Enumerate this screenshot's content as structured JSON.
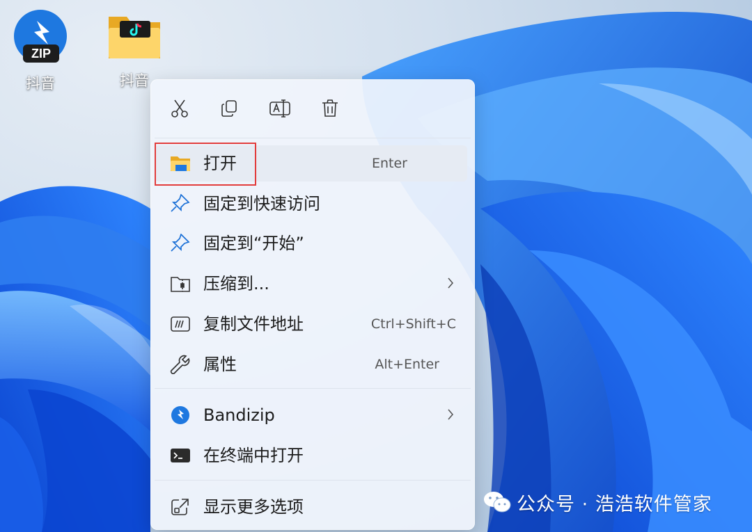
{
  "desktop": {
    "icons": [
      {
        "label": "抖音",
        "icon": "zip-archive-icon",
        "badge": "ZIP"
      },
      {
        "label": "抖音",
        "icon": "folder-icon"
      }
    ]
  },
  "context_menu": {
    "toolbar": [
      {
        "icon": "cut-icon"
      },
      {
        "icon": "copy-icon"
      },
      {
        "icon": "rename-icon"
      },
      {
        "icon": "delete-icon"
      }
    ],
    "items": [
      {
        "label": "打开",
        "shortcut": "Enter",
        "icon": "folder-open-icon",
        "highlighted": true
      },
      {
        "label": "固定到快速访问",
        "icon": "pin-icon"
      },
      {
        "label": "固定到“开始”",
        "icon": "pin-icon"
      },
      {
        "label": "压缩到...",
        "icon": "zip-folder-icon",
        "submenu": true
      },
      {
        "label": "复制文件地址",
        "shortcut": "Ctrl+Shift+C",
        "icon": "copy-path-icon"
      },
      {
        "label": "属性",
        "shortcut": "Alt+Enter",
        "icon": "wrench-icon"
      },
      {
        "label": "Bandizip",
        "icon": "bandizip-icon",
        "submenu": true
      },
      {
        "label": "在终端中打开",
        "icon": "terminal-icon"
      },
      {
        "label": "显示更多选项",
        "icon": "more-options-icon"
      }
    ]
  },
  "watermark": {
    "text": "公众号 · 浩浩软件管家",
    "icon": "wechat-icon"
  },
  "colors": {
    "accent": "#1a6fd6",
    "highlight_box": "#e23b3b",
    "menu_bg": "#f0f4fc"
  }
}
